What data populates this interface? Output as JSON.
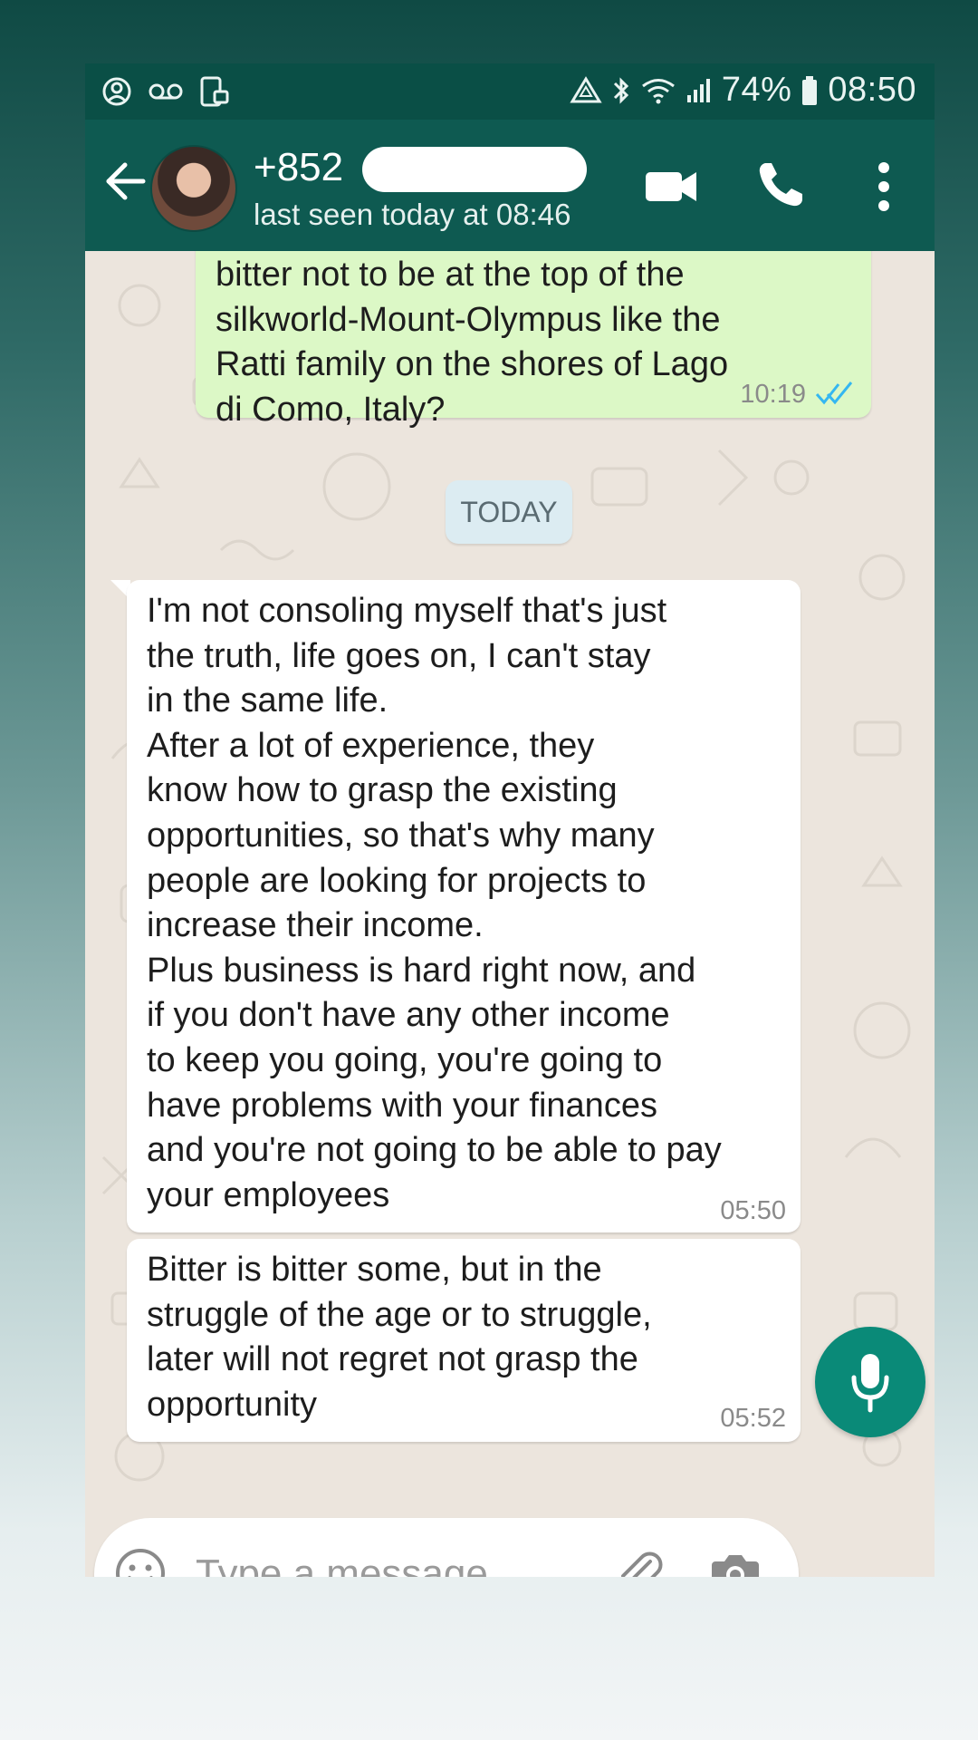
{
  "status_bar": {
    "battery": "74%",
    "time": "08:50",
    "left_icons": [
      "account-circle-icon",
      "voicemail-icon",
      "phone-lock-icon"
    ],
    "right_icons": [
      "recycle-icon",
      "bluetooth-icon",
      "wifi-icon",
      "signal-icon",
      "battery-icon"
    ]
  },
  "header": {
    "name": "+852",
    "last_seen": "last seen today at 08:46",
    "actions": [
      "video-call-icon",
      "voice-call-icon",
      "more-options-icon"
    ]
  },
  "messages": [
    {
      "direction": "out",
      "text": "bitter not to be at the top of the\nsilkworld-Mount-Olympus like the\nRatti family on the shores of Lago\ndi Como, Italy?",
      "time": "10:19",
      "status": "read"
    },
    {
      "direction": "in",
      "text": "I'm not consoling myself that's just\nthe truth, life goes on, I can't stay\nin the same life.\nAfter a lot of experience, they\nknow how to grasp the existing\nopportunities, so that's why many\npeople are looking for projects to\nincrease their income.\nPlus business is hard right now, and\nif you don't have any other income\nto keep you going, you're going to\nhave problems with your finances\nand you're not going to be able to pay\nyour employees",
      "time": "05:50"
    },
    {
      "direction": "in",
      "text": "Bitter is bitter some, but in the\nstruggle of the age or to struggle,\nlater will not regret not grasp the\nopportunity",
      "time": "05:52"
    }
  ],
  "date_divider": "TODAY",
  "composer": {
    "placeholder": "Type a message"
  },
  "colors": {
    "header": "#0e5a51",
    "status_bar": "#0a4f46",
    "outgoing_bubble": "#dcf8c6",
    "incoming_bubble": "#ffffff",
    "chat_background": "#ece5dd",
    "read_ticks": "#34b7f1",
    "mic_button": "#0a8a78"
  }
}
